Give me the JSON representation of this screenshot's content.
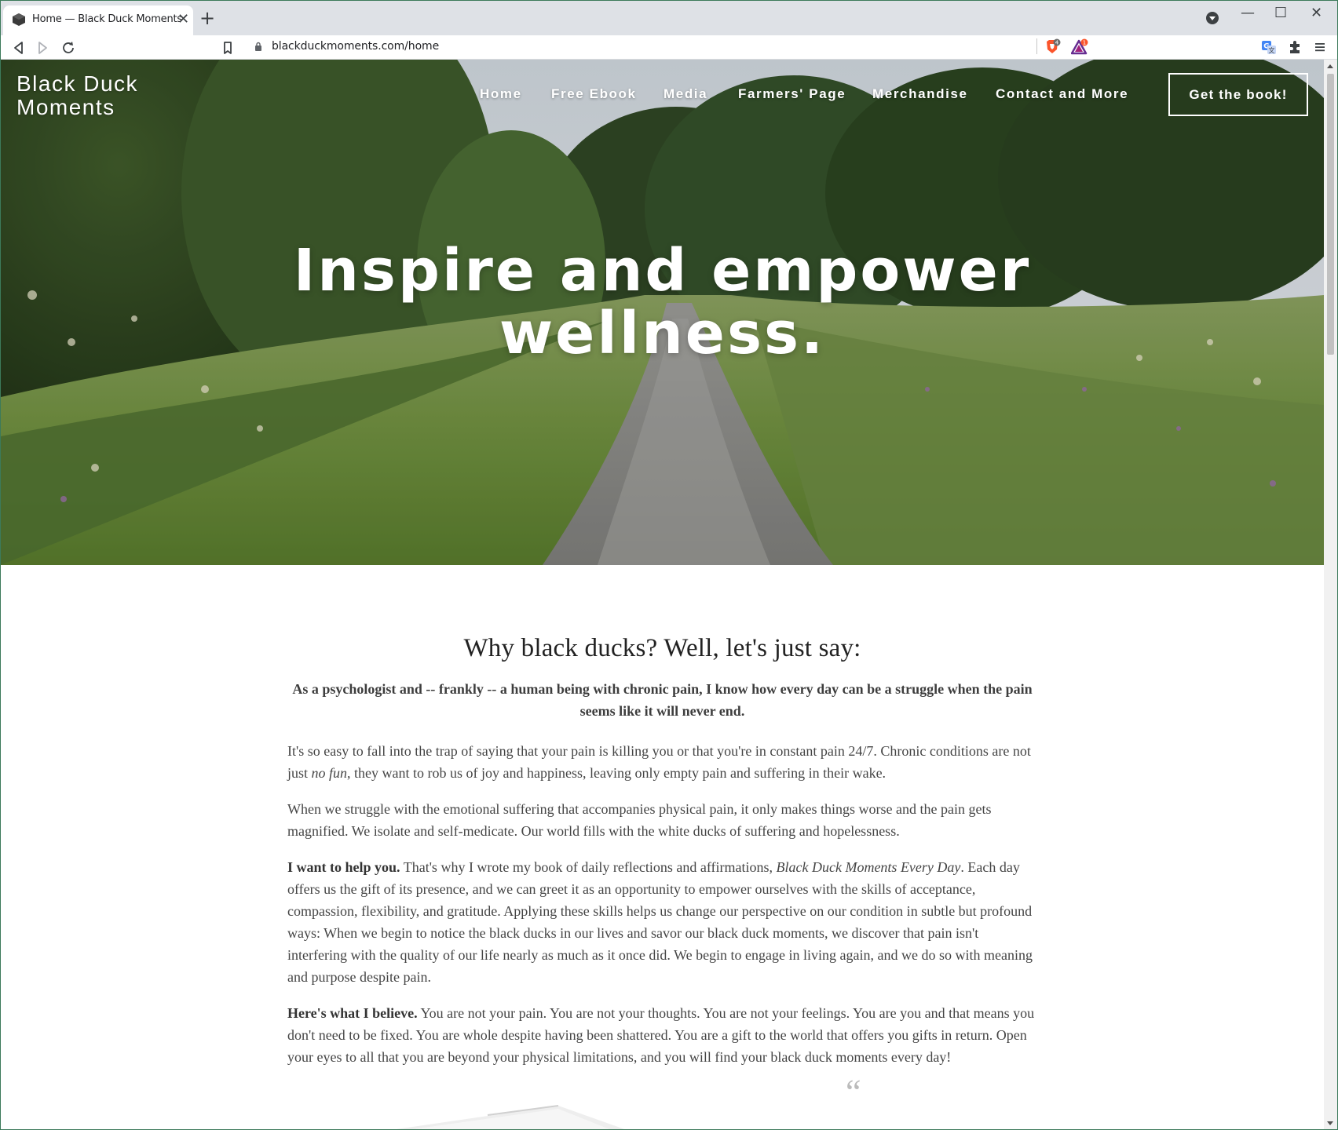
{
  "browser": {
    "tab_title": "Home — Black Duck Moments",
    "tab_close": "✕",
    "new_tab": "+",
    "url": "blackduckmoments.com/home",
    "window_controls": [
      "—",
      "☐",
      "✕"
    ],
    "icons": [
      "back-icon",
      "forward-icon",
      "reload-icon",
      "bookmark-icon",
      "lock-icon",
      "brave-shield-icon",
      "brave-rewards-icon",
      "translate-icon",
      "extensions-icon",
      "menu-icon"
    ],
    "shield_badge": "4",
    "rewards_badge": "1"
  },
  "site": {
    "title_line1": "Black Duck",
    "title_line2": "Moments",
    "nav": [
      "Home",
      "Free Ebook",
      "Media",
      "Farmers' Page",
      "Merchandise",
      "Contact and More"
    ],
    "cta": "Get the book!",
    "hero_line1": "Inspire and empower",
    "hero_line2": "wellness."
  },
  "content": {
    "heading": "Why black ducks? Well, let's just say:",
    "lead": "As a psychologist and -- frankly -- a human being with chronic pain, I know how every day can be a struggle when the pain seems like it will never end.",
    "p1_a": "It's so easy to fall into the trap of saying that your pain is killing you or that you're in constant pain 24/7. Chronic conditions are not just ",
    "p1_em": "no fun",
    "p1_b": ", they want to rob us of joy and happiness, leaving only empty pain and suffering in their wake.",
    "p2": "When we struggle with the emotional suffering that accompanies physical pain, it only makes things worse and the pain gets magnified. We isolate and self-medicate. Our world fills with the white ducks of suffering and hopelessness.",
    "p3_bold": "I want to help you.",
    "p3_a": " That's why I wrote my book of daily reflections and affirmations, ",
    "p3_em": "Black Duck Moments Every Day",
    "p3_b": ". Each day offers us the gift of its presence, and we can greet it as an opportunity to empower ourselves with the skills of acceptance, compassion, flexibility, and gratitude. Applying these skills helps us change our perspective on our condition in subtle but profound ways: When we begin to notice the black ducks in our lives and savor our black duck moments, we discover that pain isn't interfering with the quality of our life nearly as much as it once did. We begin to engage in living again, and we do so with meaning and purpose despite pain.",
    "p4_bold": "Here's what I believe.",
    "p4": " You are not your pain. You are not your thoughts. You are not your feelings. You are you and that means you don't need to be fixed. You are whole despite having been shattered. You are a gift to the world that offers you gifts in return. Open your eyes to all that you are beyond your physical limitations, and you will find your black duck moments every day!",
    "quote_mark": "“"
  },
  "colors": {
    "chrome_bg": "#dee1e6",
    "text_dark": "#222222",
    "body_text": "#444444",
    "nav_text": "#ffffff"
  }
}
